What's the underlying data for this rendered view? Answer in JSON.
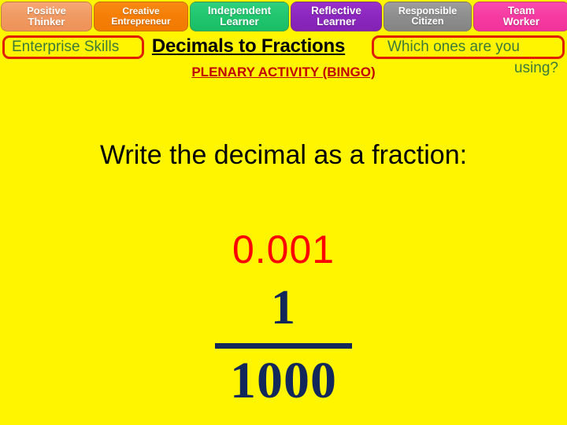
{
  "slide": {
    "background_color": "#FFF500"
  },
  "skills_bar": {
    "buttons": [
      {
        "line1": "Positive",
        "line2": "Thinker",
        "color": "#F09A63"
      },
      {
        "line1": "Creative",
        "line2": "Entrepreneur",
        "color": "#F57F06"
      },
      {
        "line1": "Independent",
        "line2": "Learner",
        "color": "#22C66F"
      },
      {
        "line1": "Reflective",
        "line2": "Learner",
        "color": "#8B27BE"
      },
      {
        "line1": "Responsible",
        "line2": "Citizen",
        "color": "#8E8E8E"
      },
      {
        "line1": "Team",
        "line2": "Worker",
        "color": "#F53BA2"
      }
    ]
  },
  "callouts": {
    "enterprise_label": "Enterprise Skills",
    "question_line1": "Which ones are you",
    "question_line2": "using?",
    "text_color": "#3B7A3B",
    "border_color": "#E02000"
  },
  "header": {
    "title": "Decimals to Fractions",
    "subtitle": "PLENARY ACTIVITY (BINGO)",
    "title_color": "#000000",
    "subtitle_color": "#C00000"
  },
  "main": {
    "instruction": "Write the decimal as a fraction:",
    "decimal": "0.001",
    "decimal_color": "#FF0000",
    "fraction": {
      "numerator": "1",
      "denominator": "1000",
      "color": "#12285A"
    }
  }
}
